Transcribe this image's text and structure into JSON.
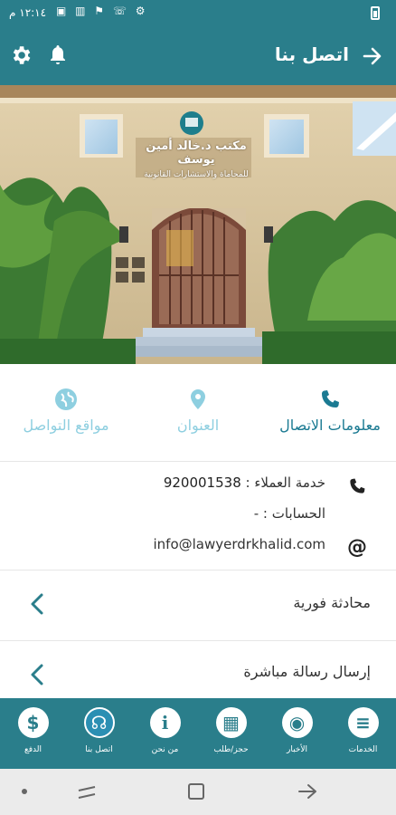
{
  "status_bar": {
    "time": "١٢:١٤ م",
    "icons": "▣ ▥ ⚑ ☏ ⚙"
  },
  "app_bar": {
    "title": "اتصل بنا"
  },
  "hero": {
    "sign_line1": "مكتب د.خالد أمين يوسف",
    "sign_line2": "للمحاماة والاستشارات القانونية"
  },
  "tabs": [
    {
      "label": "معلومات الاتصال",
      "icon": "phone-icon",
      "active": true
    },
    {
      "label": "العنوان",
      "icon": "location-pin-icon",
      "active": false
    },
    {
      "label": "مواقع التواصل",
      "icon": "globe-icon",
      "active": false
    }
  ],
  "contact": {
    "service_label": "خدمة العملاء :",
    "service_number": "920001538",
    "accounts": "الحسابات : -",
    "email": "info@lawyerdrkhalid.com"
  },
  "rows": [
    {
      "label": "محادثة فورية"
    },
    {
      "label": "إرسال رسالة مباشرة"
    }
  ],
  "bottom_nav": [
    {
      "label": "الخدمات",
      "icon": "menu-icon",
      "glyph": "≡"
    },
    {
      "label": "الأخبار",
      "icon": "rss-icon",
      "glyph": "◉"
    },
    {
      "label": "حجز/طلب",
      "icon": "calendar-icon",
      "glyph": "▦"
    },
    {
      "label": "من نحن",
      "icon": "info-icon",
      "glyph": "i"
    },
    {
      "label": "اتصل بنا",
      "icon": "headset-icon",
      "glyph": "☊"
    },
    {
      "label": "الدفع",
      "icon": "dollar-icon",
      "glyph": "$"
    }
  ],
  "colors": {
    "primary": "#2a7e8b",
    "tab_active": "#1b7a92",
    "tab_inactive": "#8ecfe0"
  }
}
